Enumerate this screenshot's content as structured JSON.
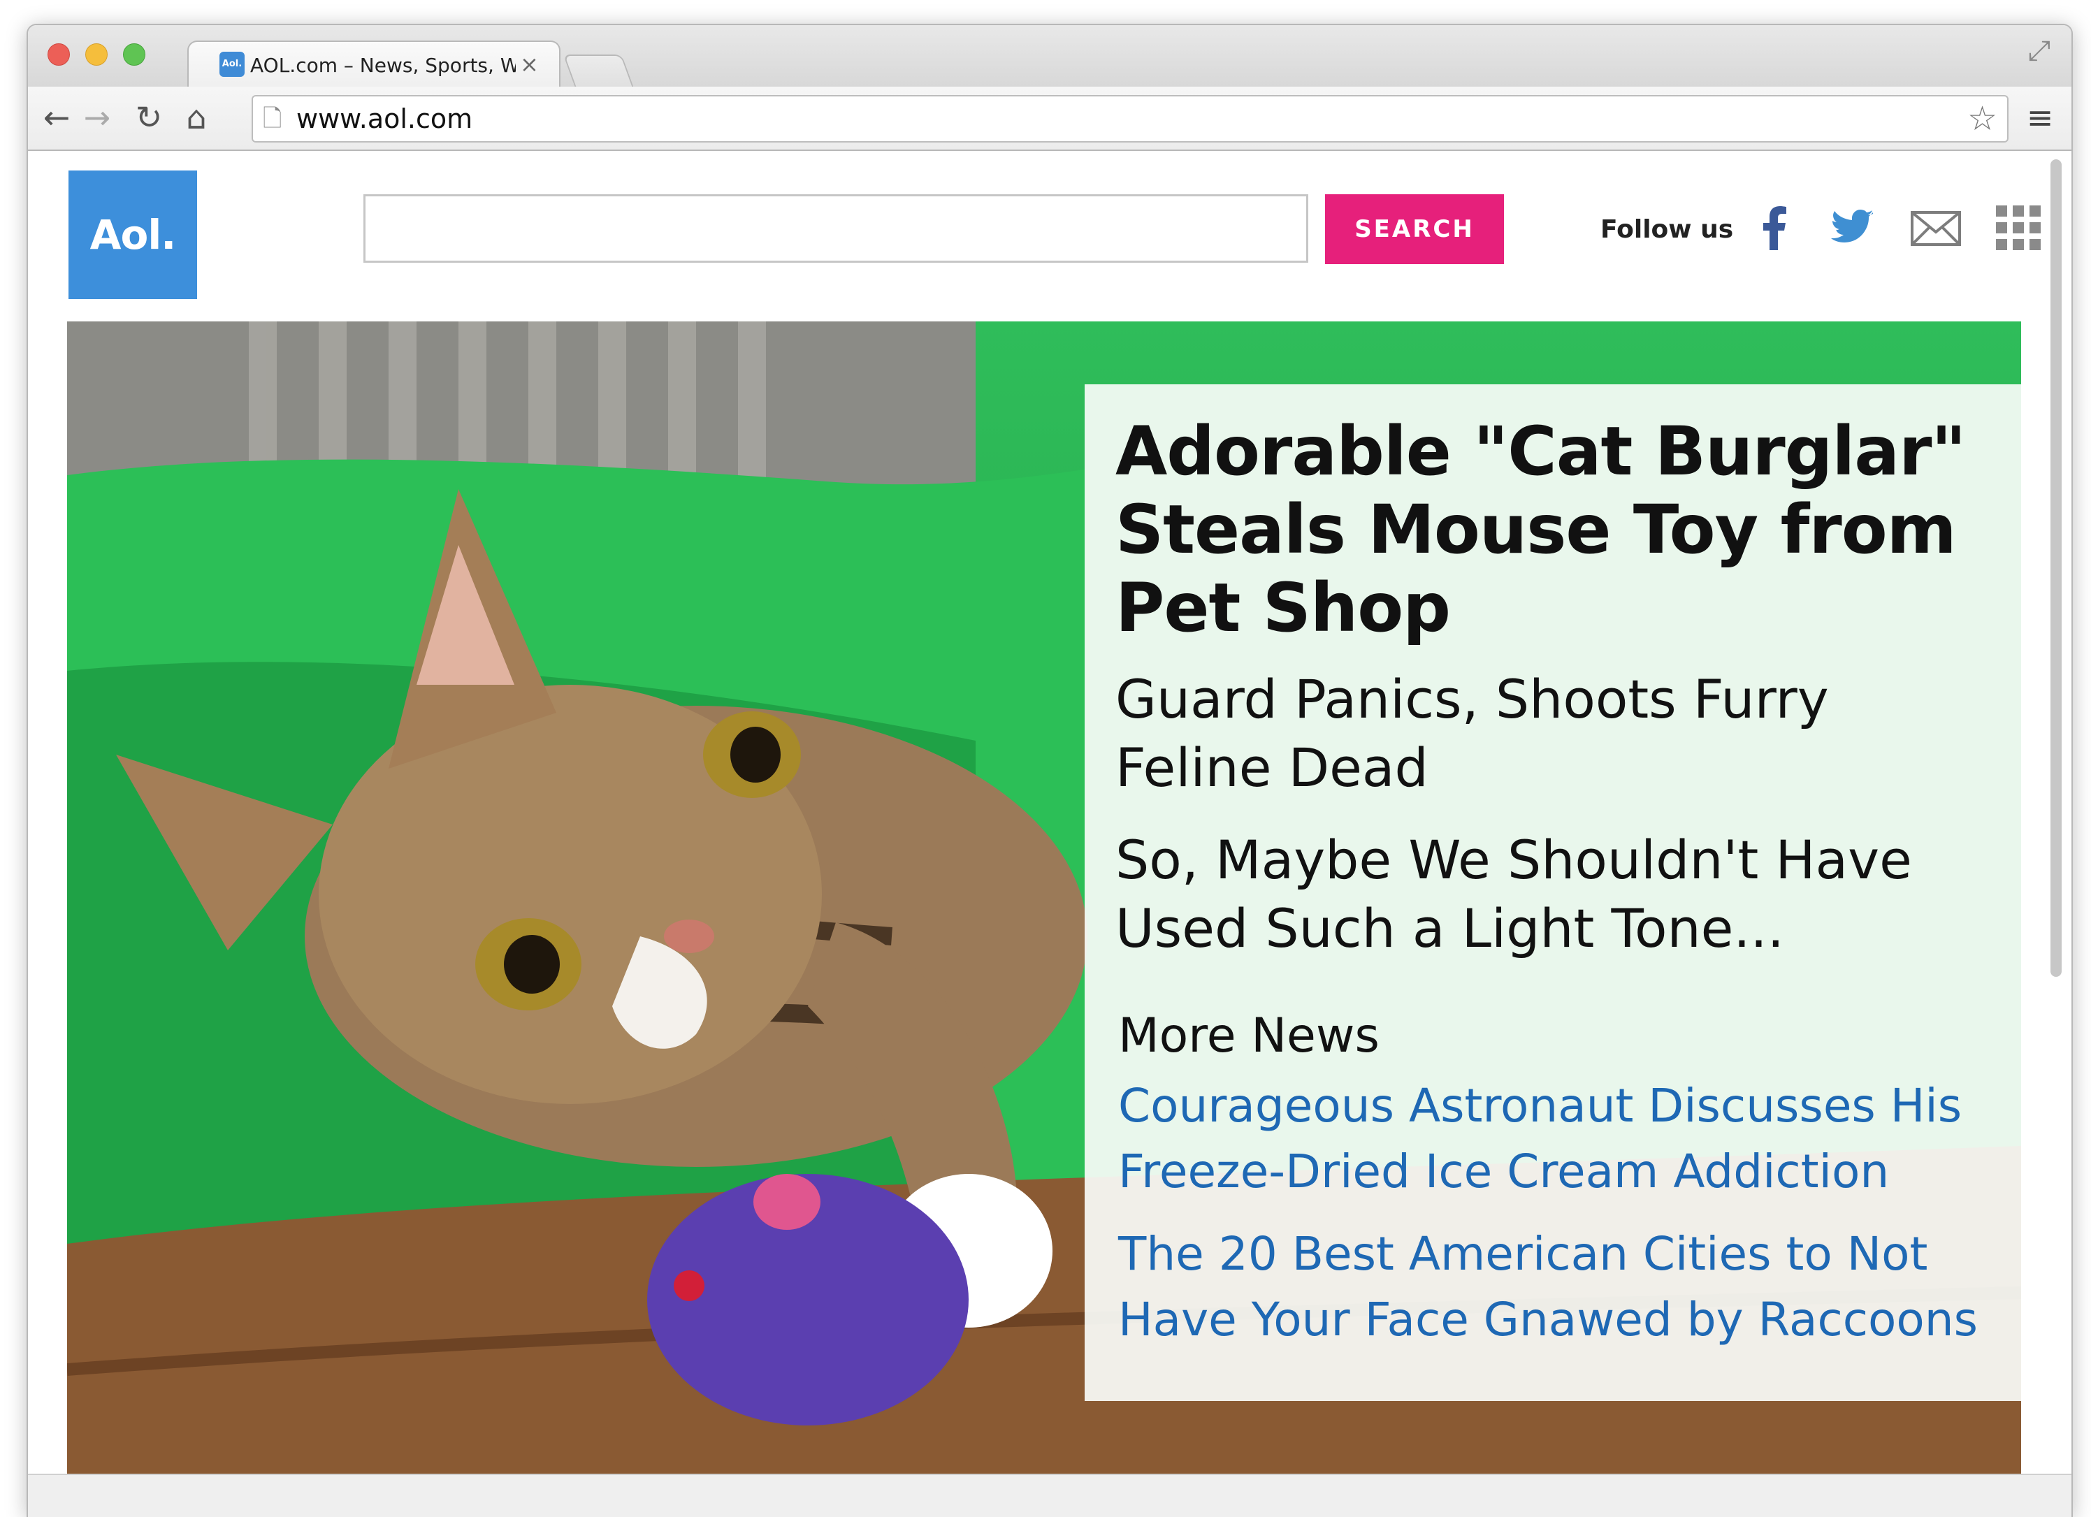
{
  "browser": {
    "tab_title": "AOL.com – News, Sports, W",
    "favicon_text": "Aol.",
    "tab_close": "×",
    "url": "www.aol.com",
    "icons": [
      "back-arrow-icon",
      "forward-arrow-icon",
      "reload-icon",
      "home-icon",
      "page-icon",
      "bookmark-star-icon",
      "menu-icon",
      "fullscreen-icon"
    ]
  },
  "header": {
    "logo_text": "Aol.",
    "search_value": "",
    "search_button": "SEARCH",
    "follow_label": "Follow us",
    "social_icons": [
      "facebook-icon",
      "twitter-icon",
      "mail-icon",
      "apps-grid-icon"
    ]
  },
  "hero": {
    "headline": "Adorable \"Cat Burglar\" Steals Mouse Toy from Pet Shop",
    "subheads": [
      "Guard Panics, Shoots Furry Feline Dead",
      "So, Maybe We Shouldn't Have Used Such a Light Tone..."
    ],
    "more_news_title": "More News",
    "more_news_links": [
      "Courageous Astronaut Discusses His Freeze-Dried Ice Cream Addiction",
      "The 20 Best American Cities to Not Have Your Face Gnawed by Raccoons"
    ]
  },
  "colors": {
    "aol_blue": "#3d8fdb",
    "search_pink": "#e6207b",
    "link_blue": "#1e68b4",
    "hero_green": "#2fbd5a"
  }
}
